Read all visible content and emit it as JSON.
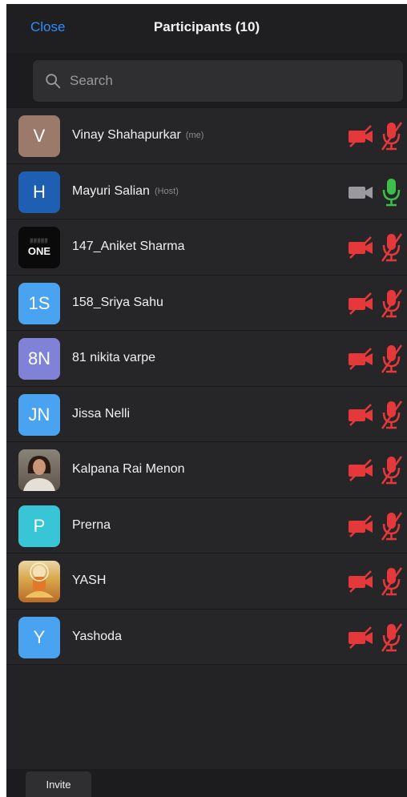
{
  "header": {
    "close_label": "Close",
    "title": "Participants (10)"
  },
  "search": {
    "placeholder": "Search",
    "icon": "search-icon"
  },
  "participants": [
    {
      "name": "Vinay Shahapurkar",
      "tag": "(me)",
      "avatar_text": "V",
      "avatar_color": "#9c7a6b",
      "video": "off",
      "audio": "muted"
    },
    {
      "name": "Mayuri Salian",
      "tag": "(Host)",
      "avatar_text": "H",
      "avatar_color": "#1f5fb3",
      "video": "inactive",
      "audio": "on"
    },
    {
      "name": "147_Aniket Sharma",
      "tag": "",
      "avatar_text": "ONE",
      "avatar_color": "#0a0a0a",
      "video": "off",
      "audio": "muted"
    },
    {
      "name": "158_Sriya Sahu",
      "tag": "",
      "avatar_text": "1S",
      "avatar_color": "#4aa3f0",
      "video": "off",
      "audio": "muted"
    },
    {
      "name": "81 nikita varpe",
      "tag": "",
      "avatar_text": "8N",
      "avatar_color": "#7f82d6",
      "video": "off",
      "audio": "muted"
    },
    {
      "name": "Jissa Nelli",
      "tag": "",
      "avatar_text": "JN",
      "avatar_color": "#4aa3f0",
      "video": "off",
      "audio": "muted"
    },
    {
      "name": "Kalpana Rai Menon",
      "tag": "",
      "avatar_text": "",
      "avatar_color": "#7a6a5a",
      "video": "off",
      "audio": "muted"
    },
    {
      "name": "Prerna",
      "tag": "",
      "avatar_text": "P",
      "avatar_color": "#38c6d6",
      "video": "off",
      "audio": "muted"
    },
    {
      "name": "YASH",
      "tag": "",
      "avatar_text": "",
      "avatar_color": "#c98a3a",
      "video": "off",
      "audio": "muted"
    },
    {
      "name": "Yashoda",
      "tag": "",
      "avatar_text": "Y",
      "avatar_color": "#4aa3f0",
      "video": "off",
      "audio": "muted"
    }
  ],
  "footer": {
    "invite_label": "Invite"
  },
  "colors": {
    "accent": "#2d8cff",
    "muted_red": "#e5383b",
    "mic_on_green": "#3bbf4a",
    "background": "#232325"
  }
}
